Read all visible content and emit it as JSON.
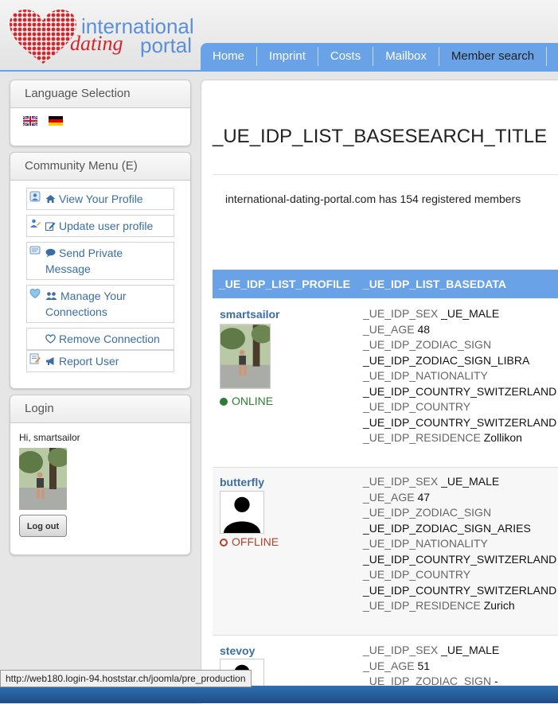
{
  "logo": {
    "line1": "international",
    "line2a": "dating",
    "line2b": "portal"
  },
  "nav": {
    "items": [
      {
        "label": "Home"
      },
      {
        "label": "Imprint"
      },
      {
        "label": "Costs"
      },
      {
        "label": "Mailbox"
      },
      {
        "label": "Member search"
      }
    ]
  },
  "sidebar": {
    "language": {
      "title": "Language Selection",
      "flags": [
        "uk-flag-icon",
        "germany-flag-icon"
      ]
    },
    "community": {
      "title": "Community Menu (E)",
      "items": [
        {
          "label": "View Your Profile"
        },
        {
          "label": "Update user profile"
        },
        {
          "label": "Send Private Message"
        },
        {
          "label": "Manage Your Connections"
        },
        {
          "label": "Remove Connection"
        },
        {
          "label": "Report User"
        }
      ]
    },
    "login": {
      "title": "Login",
      "greeting": "Hi, smartsailor",
      "logout_label": "Log out"
    }
  },
  "main": {
    "title": "_UE_IDP_LIST_BASESEARCH_TITLE",
    "count_text": "international-dating-portal.com has 154 registered members",
    "columns": [
      "_UE_IDP_LIST_PROFILE",
      "_UE_IDP_LIST_BASEDATA"
    ],
    "members": [
      {
        "username": "smartsailor",
        "status": "ONLINE",
        "fields": [
          {
            "label": "_UE_IDP_SEX",
            "value": "_UE_MALE"
          },
          {
            "label": "_UE_AGE",
            "value": "48"
          },
          {
            "label": "_UE_IDP_ZODIAC_SIGN",
            "value": ""
          },
          {
            "label": "",
            "value": "_UE_IDP_ZODIAC_SIGN_LIBRA"
          },
          {
            "label": "_UE_IDP_NATIONALITY",
            "value": ""
          },
          {
            "label": "",
            "value": "_UE_IDP_COUNTRY_SWITZERLAND"
          },
          {
            "label": "_UE_IDP_COUNTRY",
            "value": ""
          },
          {
            "label": "",
            "value": "_UE_IDP_COUNTRY_SWITZERLAND"
          },
          {
            "label": "_UE_IDP_RESIDENCE",
            "value": "Zollikon"
          }
        ]
      },
      {
        "username": "butterfly",
        "status": "OFFLINE",
        "fields": [
          {
            "label": "_UE_IDP_SEX",
            "value": "_UE_MALE"
          },
          {
            "label": "_UE_AGE",
            "value": "47"
          },
          {
            "label": "_UE_IDP_ZODIAC_SIGN",
            "value": ""
          },
          {
            "label": "",
            "value": "_UE_IDP_ZODIAC_SIGN_ARIES"
          },
          {
            "label": "_UE_IDP_NATIONALITY",
            "value": ""
          },
          {
            "label": "",
            "value": "_UE_IDP_COUNTRY_SWITZERLAND"
          },
          {
            "label": "_UE_IDP_COUNTRY",
            "value": ""
          },
          {
            "label": "",
            "value": "_UE_IDP_COUNTRY_SWITZERLAND"
          },
          {
            "label": "_UE_IDP_RESIDENCE",
            "value": "Zurich"
          }
        ]
      },
      {
        "username": "stevoy",
        "status": "",
        "fields": [
          {
            "label": "_UE_IDP_SEX",
            "value": "_UE_MALE"
          },
          {
            "label": "_UE_AGE",
            "value": "51"
          },
          {
            "label": "_UE_IDP_ZODIAC_SIGN",
            "value": "-"
          }
        ]
      }
    ]
  },
  "statusbar": {
    "url": "http://web180.login-94.hoststar.ch/joomla/pre_production"
  },
  "colors": {
    "accent": "#6aa2e8",
    "link": "#3a6ea5",
    "online": "#2e7d32",
    "offline": "#b0432a",
    "logo_red": "#d8232a"
  }
}
